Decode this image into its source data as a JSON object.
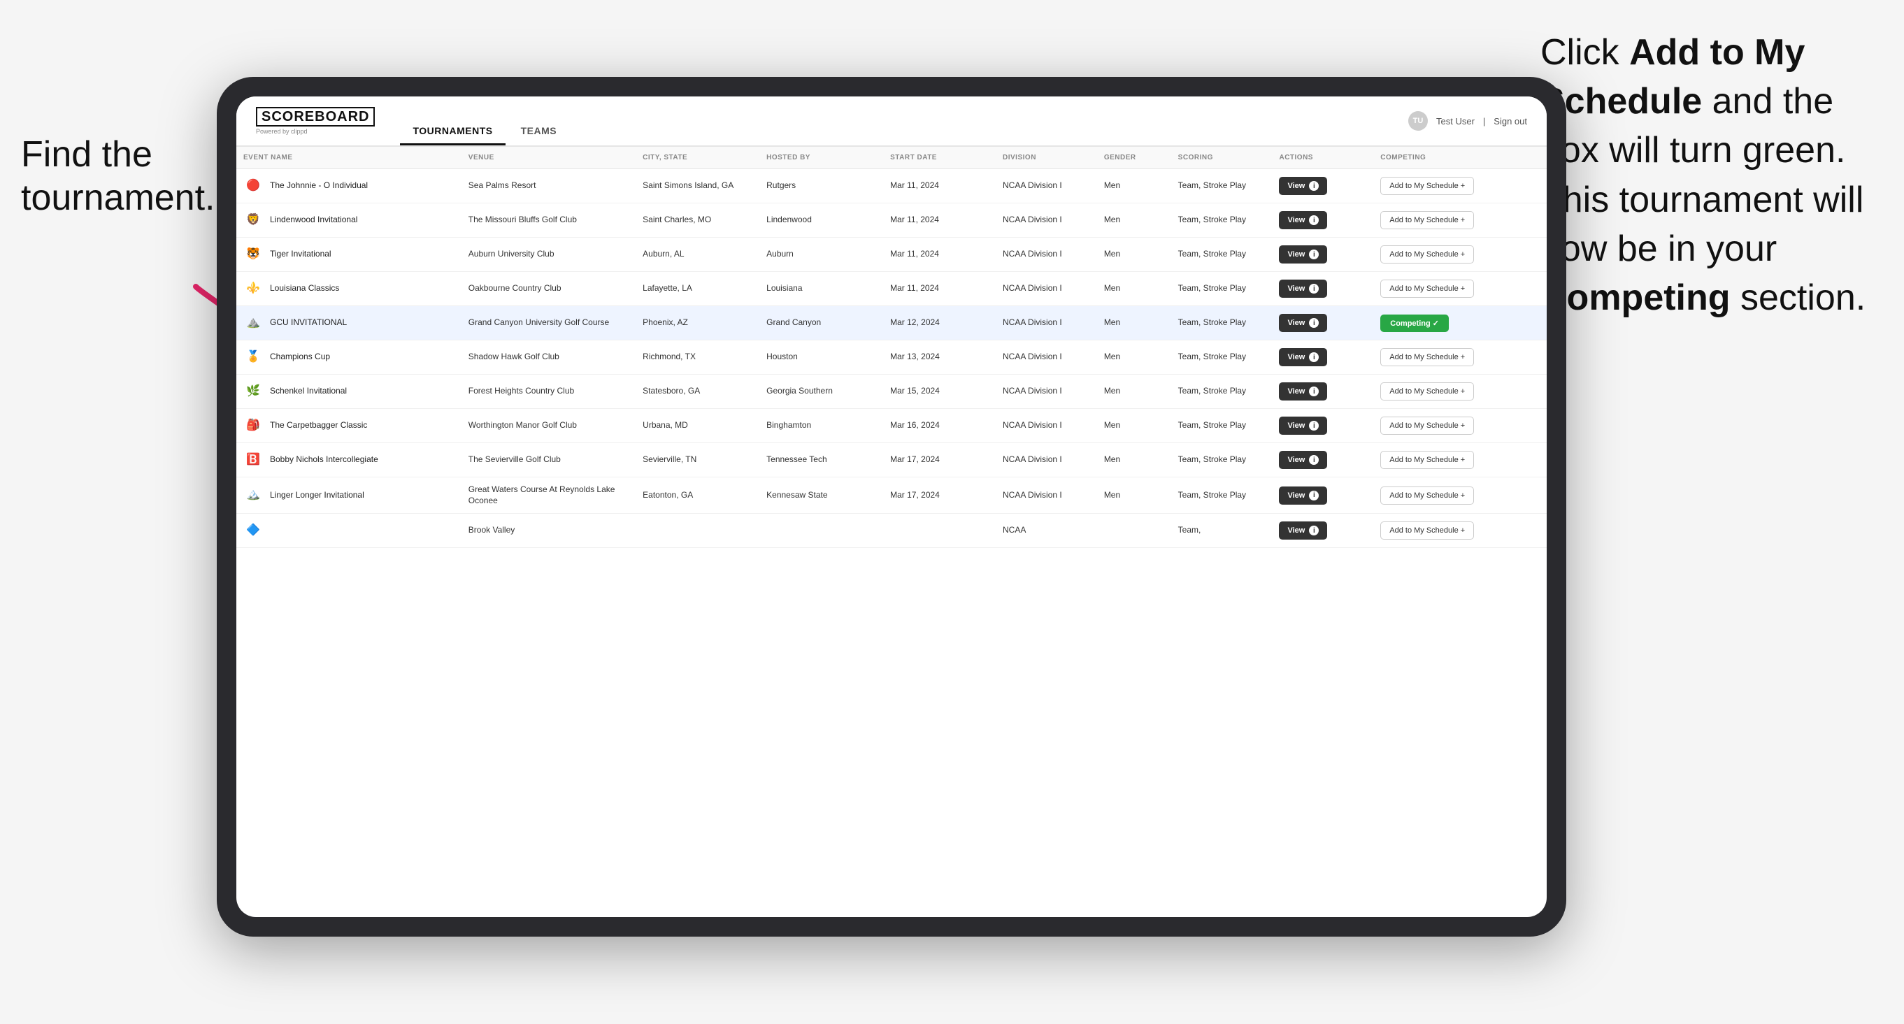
{
  "annotations": {
    "left": "Find the\ntournament.",
    "right_part1": "Click ",
    "right_bold1": "Add to My\nSchedule",
    "right_part2": " and the\nbox will turn green.\nThis tournament\nwill now be in\nyour ",
    "right_bold2": "Competing",
    "right_part3": "\nsection."
  },
  "header": {
    "logo": "SCOREBOARD",
    "logo_sub": "Powered by clippd",
    "nav_tabs": [
      "TOURNAMENTS",
      "TEAMS"
    ],
    "active_tab": "TOURNAMENTS",
    "user": "Test User",
    "sign_out": "Sign out"
  },
  "table": {
    "columns": [
      "EVENT NAME",
      "VENUE",
      "CITY, STATE",
      "HOSTED BY",
      "START DATE",
      "DIVISION",
      "GENDER",
      "SCORING",
      "ACTIONS",
      "COMPETING"
    ],
    "rows": [
      {
        "logo": "🔴",
        "event": "The Johnnie - O Individual",
        "venue": "Sea Palms Resort",
        "city": "Saint Simons Island, GA",
        "hosted": "Rutgers",
        "date": "Mar 11, 2024",
        "division": "NCAA Division I",
        "gender": "Men",
        "scoring": "Team, Stroke Play",
        "view_label": "View",
        "action_label": "Add to My Schedule +",
        "status": "add",
        "highlighted": false
      },
      {
        "logo": "🦁",
        "event": "Lindenwood Invitational",
        "venue": "The Missouri Bluffs Golf Club",
        "city": "Saint Charles, MO",
        "hosted": "Lindenwood",
        "date": "Mar 11, 2024",
        "division": "NCAA Division I",
        "gender": "Men",
        "scoring": "Team, Stroke Play",
        "view_label": "View",
        "action_label": "Add to My Schedule +",
        "status": "add",
        "highlighted": false
      },
      {
        "logo": "🐯",
        "event": "Tiger Invitational",
        "venue": "Auburn University Club",
        "city": "Auburn, AL",
        "hosted": "Auburn",
        "date": "Mar 11, 2024",
        "division": "NCAA Division I",
        "gender": "Men",
        "scoring": "Team, Stroke Play",
        "view_label": "View",
        "action_label": "Add to My Schedule +",
        "status": "add",
        "highlighted": false
      },
      {
        "logo": "⚜️",
        "event": "Louisiana Classics",
        "venue": "Oakbourne Country Club",
        "city": "Lafayette, LA",
        "hosted": "Louisiana",
        "date": "Mar 11, 2024",
        "division": "NCAA Division I",
        "gender": "Men",
        "scoring": "Team, Stroke Play",
        "view_label": "View",
        "action_label": "Add to My Schedule +",
        "status": "add",
        "highlighted": false
      },
      {
        "logo": "⛰️",
        "event": "GCU INVITATIONAL",
        "venue": "Grand Canyon University Golf Course",
        "city": "Phoenix, AZ",
        "hosted": "Grand Canyon",
        "date": "Mar 12, 2024",
        "division": "NCAA Division I",
        "gender": "Men",
        "scoring": "Team, Stroke Play",
        "view_label": "View",
        "action_label": "Competing ✓",
        "status": "competing",
        "highlighted": true
      },
      {
        "logo": "🏅",
        "event": "Champions Cup",
        "venue": "Shadow Hawk Golf Club",
        "city": "Richmond, TX",
        "hosted": "Houston",
        "date": "Mar 13, 2024",
        "division": "NCAA Division I",
        "gender": "Men",
        "scoring": "Team, Stroke Play",
        "view_label": "View",
        "action_label": "Add to My Schedule +",
        "status": "add",
        "highlighted": false
      },
      {
        "logo": "🌿",
        "event": "Schenkel Invitational",
        "venue": "Forest Heights Country Club",
        "city": "Statesboro, GA",
        "hosted": "Georgia Southern",
        "date": "Mar 15, 2024",
        "division": "NCAA Division I",
        "gender": "Men",
        "scoring": "Team, Stroke Play",
        "view_label": "View",
        "action_label": "Add to My Schedule +",
        "status": "add",
        "highlighted": false
      },
      {
        "logo": "🎒",
        "event": "The Carpetbagger Classic",
        "venue": "Worthington Manor Golf Club",
        "city": "Urbana, MD",
        "hosted": "Binghamton",
        "date": "Mar 16, 2024",
        "division": "NCAA Division I",
        "gender": "Men",
        "scoring": "Team, Stroke Play",
        "view_label": "View",
        "action_label": "Add to My Schedule +",
        "status": "add",
        "highlighted": false
      },
      {
        "logo": "🅱️",
        "event": "Bobby Nichols Intercollegiate",
        "venue": "The Sevierville Golf Club",
        "city": "Sevierville, TN",
        "hosted": "Tennessee Tech",
        "date": "Mar 17, 2024",
        "division": "NCAA Division I",
        "gender": "Men",
        "scoring": "Team, Stroke Play",
        "view_label": "View",
        "action_label": "Add to My Schedule +",
        "status": "add",
        "highlighted": false
      },
      {
        "logo": "🏔️",
        "event": "Linger Longer Invitational",
        "venue": "Great Waters Course At Reynolds Lake Oconee",
        "city": "Eatonton, GA",
        "hosted": "Kennesaw State",
        "date": "Mar 17, 2024",
        "division": "NCAA Division I",
        "gender": "Men",
        "scoring": "Team, Stroke Play",
        "view_label": "View",
        "action_label": "Add to My Schedule +",
        "status": "add",
        "highlighted": false
      },
      {
        "logo": "🔷",
        "event": "",
        "venue": "Brook Valley",
        "city": "",
        "hosted": "",
        "date": "",
        "division": "NCAA",
        "gender": "",
        "scoring": "Team,",
        "view_label": "View",
        "action_label": "Add to My Schedule +",
        "status": "add",
        "highlighted": false
      }
    ]
  }
}
